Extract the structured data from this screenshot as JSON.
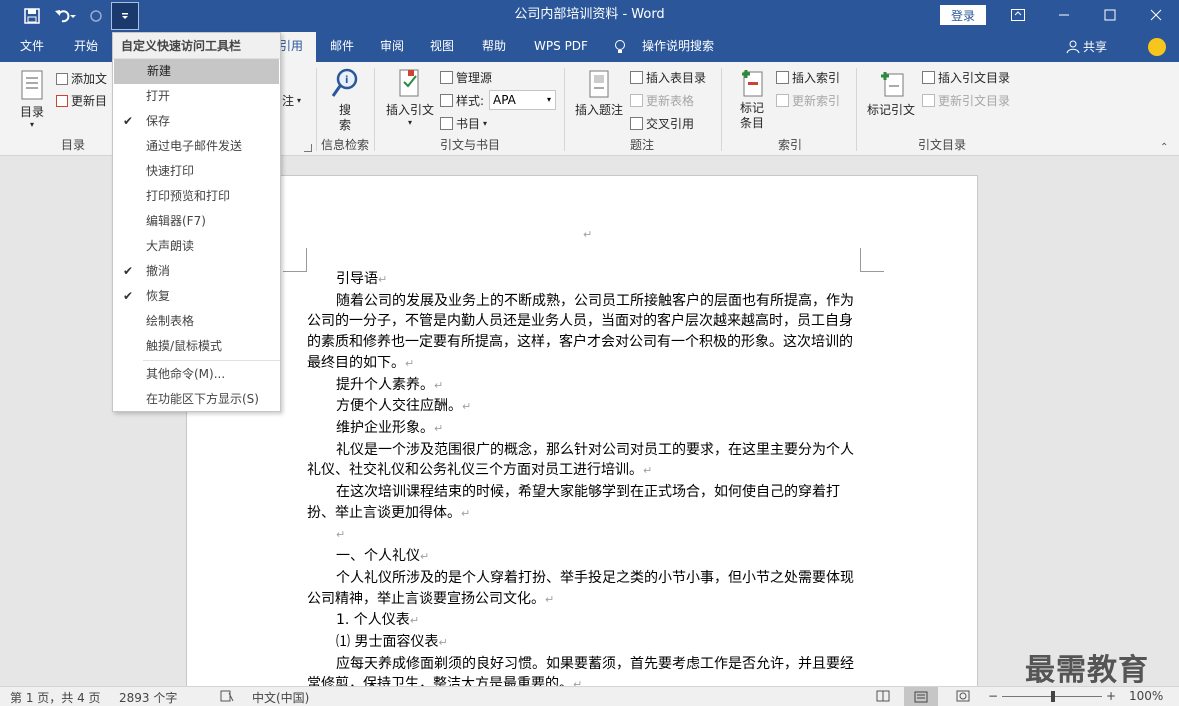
{
  "window": {
    "title": "公司内部培训资料  -  Word",
    "login_label": "登录"
  },
  "tabs": [
    "文件",
    "开始",
    "引用",
    "邮件",
    "审阅",
    "视图",
    "帮助",
    "WPS PDF",
    "操作说明搜索"
  ],
  "share_label": "共享",
  "ribbon": {
    "toc": {
      "big_label": "目录",
      "add_text": "添加文",
      "update": "更新目",
      "group": "目录"
    },
    "footnote_fragment": "注",
    "search": {
      "label": "搜索",
      "group": "信息检索"
    },
    "citations": {
      "insert_citation": "插入引文",
      "manage_sources": "管理源",
      "style_label": "样式:",
      "style_value": "APA",
      "bibliography": "书目",
      "group": "引文与书目"
    },
    "captions": {
      "insert_caption": "插入题注",
      "insert_table_of_figures": "插入表目录",
      "update_table": "更新表格",
      "cross_reference": "交叉引用",
      "group": "题注"
    },
    "index": {
      "mark_entry": "标记条目",
      "insert_index": "插入索引",
      "update_index": "更新索引",
      "group": "索引"
    },
    "toa": {
      "mark_citation": "标记引文",
      "insert_toa": "插入引文目录",
      "update_toa": "更新引文目录",
      "group": "引文目录"
    }
  },
  "qat_menu": {
    "title": "自定义快速访问工具栏",
    "items": [
      {
        "label": "新建",
        "checked": false,
        "highlighted": true
      },
      {
        "label": "打开",
        "checked": false
      },
      {
        "label": "保存",
        "checked": true
      },
      {
        "label": "通过电子邮件发送",
        "checked": false
      },
      {
        "label": "快速打印",
        "checked": false
      },
      {
        "label": "打印预览和打印",
        "checked": false
      },
      {
        "label": "编辑器(F7)",
        "checked": false
      },
      {
        "label": "大声朗读",
        "checked": false
      },
      {
        "label": "撤消",
        "checked": true
      },
      {
        "label": "恢复",
        "checked": true
      },
      {
        "label": "绘制表格",
        "checked": false
      },
      {
        "label": "触摸/鼠标模式",
        "checked": false
      },
      {
        "label": "其他命令(M)...",
        "checked": false
      },
      {
        "label": "在功能区下方显示(S)",
        "checked": false
      }
    ]
  },
  "document": {
    "paragraphs": [
      "引导语",
      "随着公司的发展及业务上的不断成熟，公司员工所接触客户的层面也有所提高，作为公司的一分子，不管是内勤人员还是业务人员，当面对的客户层次越来越高时，员工自身的素质和修养也一定要有所提高，这样，客户才会对公司有一个积极的形象。这次培训的最终目的如下。",
      "提升个人素养。",
      "方便个人交往应酬。",
      "维护企业形象。",
      "礼仪是一个涉及范围很广的概念，那么针对公司对员工的要求，在这里主要分为个人礼仪、社交礼仪和公务礼仪三个方面对员工进行培训。",
      "在这次培训课程结束的时候，希望大家能够学到在正式场合，如何使自己的穿着打扮、举止言谈更加得体。",
      "",
      "一、个人礼仪",
      "个人礼仪所涉及的是个人穿着打扮、举手投足之类的小节小事，但小节之处需要体现公司精神，举止言谈要宣扬公司文化。",
      "1.  个人仪表",
      "⑴ 男士面容仪表",
      "应每天养成修面剃须的良好习惯。如果要蓄须，首先要考虑工作是否允许，并且要经常修剪，保持卫生，整洁大方是最重要的。"
    ]
  },
  "status": {
    "page": "第 1 页，共 4 页",
    "words": "2893 个字",
    "language": "中文(中国)",
    "zoom": "100%"
  },
  "watermark": "最需教育"
}
